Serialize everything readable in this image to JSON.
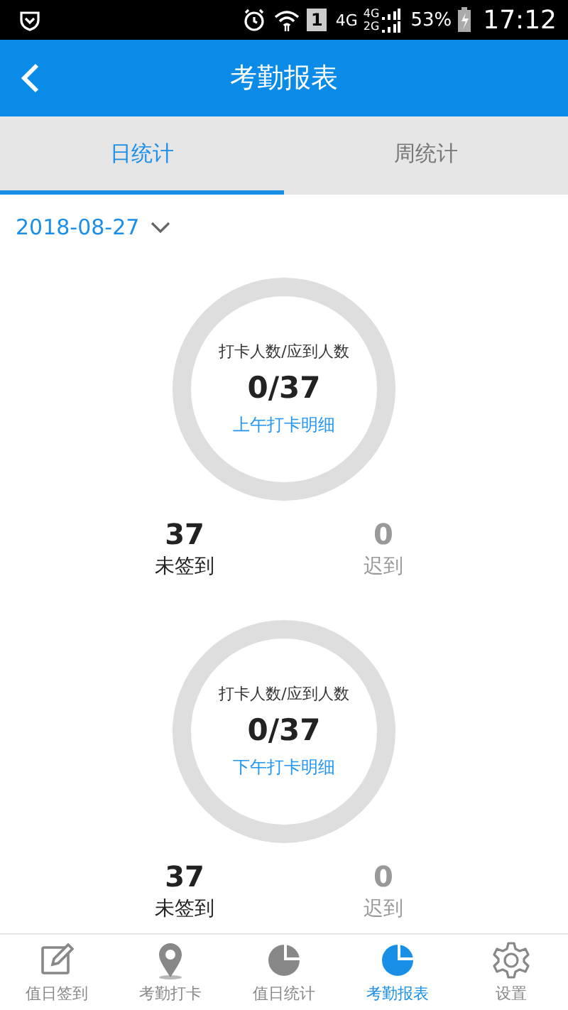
{
  "status_bar": {
    "sim": "1",
    "network_1": "4G",
    "network_2_top": "4G",
    "network_2_bottom": "2G",
    "battery": "53%",
    "time": "17:12"
  },
  "header": {
    "title": "考勤报表"
  },
  "tabs": [
    {
      "label": "日统计",
      "selected": true
    },
    {
      "label": "周统计",
      "selected": false
    }
  ],
  "date_picker": {
    "value": "2018-08-27"
  },
  "sections": [
    {
      "caption": "打卡人数/应到人数",
      "ratio": "0/37",
      "link": "上午打卡明细",
      "stats": [
        {
          "value": "37",
          "label": "未签到",
          "kind": "primary"
        },
        {
          "value": "0",
          "label": "迟到",
          "kind": "muted"
        }
      ]
    },
    {
      "caption": "打卡人数/应到人数",
      "ratio": "0/37",
      "link": "下午打卡明细",
      "stats": [
        {
          "value": "37",
          "label": "未签到",
          "kind": "primary"
        },
        {
          "value": "0",
          "label": "迟到",
          "kind": "muted"
        }
      ]
    }
  ],
  "bottom_nav": [
    {
      "label": "值日签到",
      "selected": false
    },
    {
      "label": "考勤打卡",
      "selected": false
    },
    {
      "label": "值日统计",
      "selected": false
    },
    {
      "label": "考勤报表",
      "selected": true
    },
    {
      "label": "设置",
      "selected": false
    }
  ]
}
